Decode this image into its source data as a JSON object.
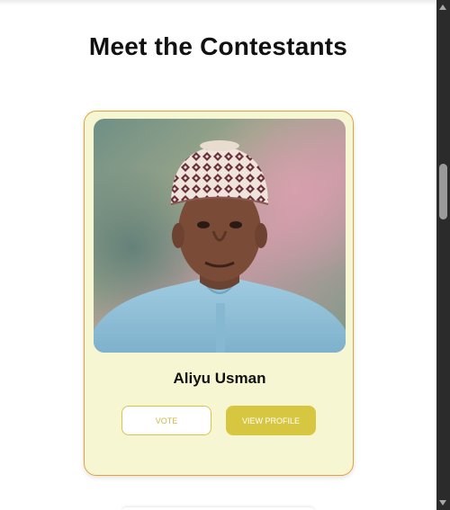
{
  "section": {
    "title": "Meet the Contestants"
  },
  "contestant": {
    "name": "Aliyu Usman",
    "vote_label": "VOTE",
    "profile_label": "VIEW PROFILE"
  },
  "colors": {
    "card_background": "#f7f6d3",
    "card_border": "#e3a33a",
    "accent": "#d7c640"
  }
}
